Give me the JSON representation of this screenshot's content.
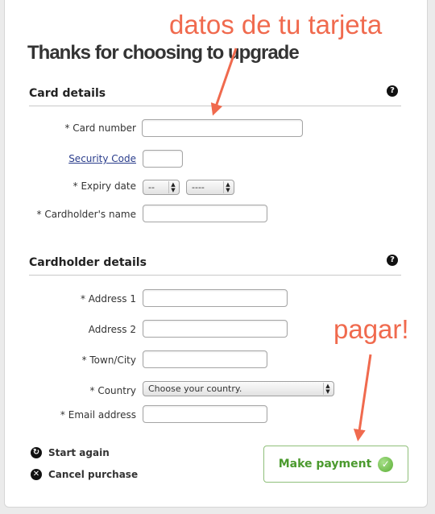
{
  "page": {
    "title": "Thanks for choosing to upgrade"
  },
  "card_section": {
    "title": "Card details",
    "help_icon": "?",
    "card_number_label": "* Card number",
    "card_number_value": "",
    "security_code_label": "Security Code",
    "security_code_value": "",
    "expiry_label": "* Expiry date",
    "expiry_month": "--",
    "expiry_year": "----",
    "cardholder_name_label": "* Cardholder's name",
    "cardholder_name_value": ""
  },
  "holder_section": {
    "title": "Cardholder details",
    "help_icon": "?",
    "address1_label": "* Address 1",
    "address2_label": "Address 2",
    "town_label": "* Town/City",
    "country_label": "* Country",
    "country_value": "Choose your country.",
    "email_label": "* Email address"
  },
  "actions": {
    "start_again": "Start again",
    "cancel_purchase": "Cancel purchase",
    "make_payment": "Make payment"
  },
  "annotations": {
    "card_note": "datos de tu tarjeta",
    "pay_note": "pagar!",
    "color": "#f06a4e"
  },
  "icons": {
    "start_again": "restart-icon",
    "cancel": "cancel-icon",
    "payment": "check-icon",
    "help": "help-icon"
  }
}
